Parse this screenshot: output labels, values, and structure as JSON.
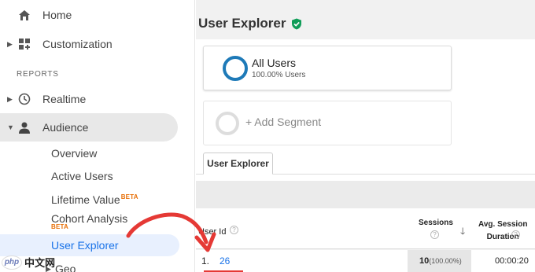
{
  "sidebar": {
    "home": "Home",
    "customization": "Customization",
    "reports_heading": "REPORTS",
    "realtime": "Realtime",
    "audience": "Audience",
    "sub_items": {
      "overview": "Overview",
      "active_users": "Active Users",
      "lifetime_value": "Lifetime Value",
      "lifetime_value_badge": "BETA",
      "cohort_analysis": "Cohort Analysis",
      "cohort_analysis_badge": "BETA",
      "user_explorer": "User Explorer",
      "geo": "Geo"
    }
  },
  "main": {
    "title": "User Explorer",
    "segments": [
      {
        "name": "All Users",
        "subtitle": "100.00% Users"
      },
      {
        "name": "+ Add Segment"
      }
    ],
    "tab": "User Explorer",
    "table": {
      "headers": {
        "user_id": "User Id",
        "sessions": "Sessions",
        "avg_session_line1": "Avg. Session",
        "avg_session_line2": "Duration"
      },
      "help_icon": "?",
      "rows": [
        {
          "num": "1.",
          "user_id": "26",
          "sessions": "10",
          "sessions_pct": "(100.00%)",
          "duration": "00:00:20"
        }
      ]
    }
  },
  "watermark": {
    "logo": "php",
    "text": "中文网"
  },
  "colors": {
    "accent": "#1a73e8",
    "segment_ring": "#1e7ab8",
    "verified_shield": "#0f9d58",
    "beta": "#e8710a",
    "annotation_arrow": "#e53935"
  }
}
